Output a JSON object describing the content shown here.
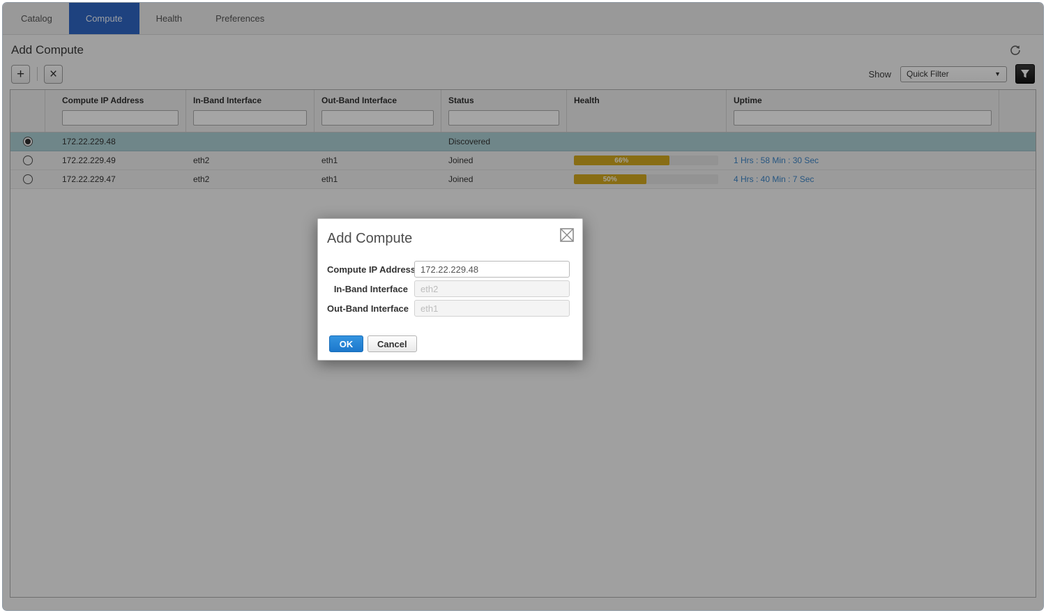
{
  "tabs": [
    {
      "label": "Catalog",
      "active": false
    },
    {
      "label": "Compute",
      "active": true
    },
    {
      "label": "Health",
      "active": false
    },
    {
      "label": "Preferences",
      "active": false
    }
  ],
  "page": {
    "title": "Add Compute"
  },
  "toolbar": {
    "add_icon": "+",
    "delete_icon": "×",
    "show_label": "Show",
    "filter_dropdown_value": "Quick Filter",
    "dropdown_caret": "▼",
    "icons": [
      "refresh-icon",
      "funnel-filter-icon"
    ]
  },
  "table": {
    "columns": [
      "Compute IP Address",
      "In-Band Interface",
      "Out-Band Interface",
      "Status",
      "Health",
      "Uptime"
    ],
    "filter_inputs": [
      "Compute IP Address",
      "In-Band Interface",
      "Out-Band Interface",
      "Status",
      "Uptime"
    ],
    "rows": [
      {
        "ip": "172.22.229.48",
        "in_band": "",
        "out_band": "",
        "status": "Discovered",
        "health_pct": null,
        "health_label": "",
        "uptime": "",
        "selected": true
      },
      {
        "ip": "172.22.229.49",
        "in_band": "eth2",
        "out_band": "eth1",
        "status": "Joined",
        "health_pct": 66,
        "health_label": "66%",
        "uptime": "1 Hrs : 58 Min : 30 Sec",
        "selected": false
      },
      {
        "ip": "172.22.229.47",
        "in_band": "eth2",
        "out_band": "eth1",
        "status": "Joined",
        "health_pct": 50,
        "health_label": "50%",
        "uptime": "4 Hrs : 40 Min : 7 Sec",
        "selected": false
      }
    ]
  },
  "dialog": {
    "title": "Add Compute",
    "close_icon": "boxed-x",
    "fields": [
      {
        "label": "Compute IP Address",
        "value": "172.22.229.48",
        "placeholder": "",
        "disabled": false
      },
      {
        "label": "In-Band Interface",
        "value": "",
        "placeholder": "eth2",
        "disabled": true
      },
      {
        "label": "Out-Band Interface",
        "value": "",
        "placeholder": "eth1",
        "disabled": true
      }
    ],
    "ok_label": "OK",
    "cancel_label": "Cancel"
  },
  "colors": {
    "tab_active_bg": "#2f66c4",
    "selected_row": "#abced3",
    "health_yellow": "#d2a81f",
    "link_blue": "#3d85c6",
    "ok_blue": "#1c78cc",
    "ok_blue_light": "#3494e0"
  }
}
